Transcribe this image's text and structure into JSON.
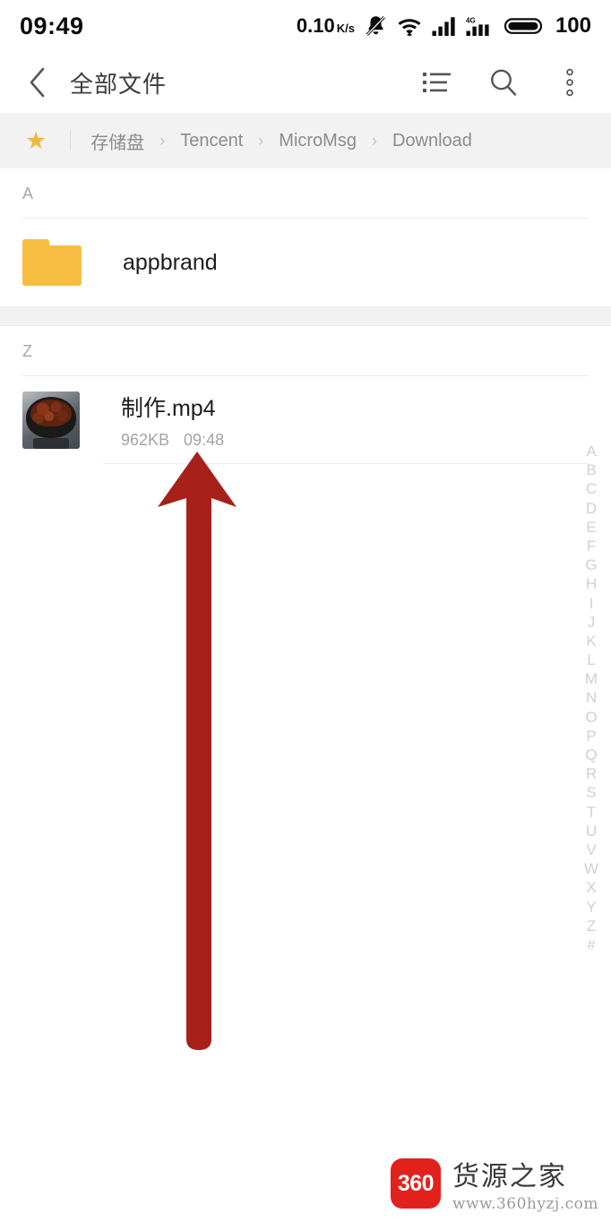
{
  "statusbar": {
    "time": "09:49",
    "net_speed_value": "0.10",
    "net_speed_unit_num": "K",
    "net_speed_unit_den": "s",
    "mute_icon": "bell-muted-icon",
    "wifi_icon": "wifi-icon",
    "signal_icon": "cellular-signal-icon",
    "signal_4g_icon": "cellular-4g-signal-icon",
    "signal_4g_label": "4G",
    "battery_icon": "battery-full-icon",
    "battery_level": "100"
  },
  "appbar": {
    "back_icon": "back-chevron-icon",
    "title": "全部文件",
    "list_view_icon": "list-view-icon",
    "search_icon": "search-icon",
    "more_icon": "more-vertical-icon"
  },
  "breadcrumb": {
    "star_icon": "star-icon",
    "items": [
      {
        "label": "存储盘"
      },
      {
        "label": "Tencent"
      },
      {
        "label": "MicroMsg"
      },
      {
        "label": "Download"
      }
    ],
    "separator": "›"
  },
  "sections": [
    {
      "letter": "A",
      "rows": [
        {
          "type": "folder",
          "icon": "folder-icon",
          "name": "appbrand"
        }
      ]
    },
    {
      "letter": "Z",
      "rows": [
        {
          "type": "video",
          "icon": "video-thumbnail",
          "name": "制作.mp4",
          "size": "962KB",
          "time": "09:48"
        }
      ]
    }
  ],
  "alpha_index": [
    "A",
    "B",
    "C",
    "D",
    "E",
    "F",
    "G",
    "H",
    "I",
    "J",
    "K",
    "L",
    "M",
    "N",
    "O",
    "P",
    "Q",
    "R",
    "S",
    "T",
    "U",
    "V",
    "W",
    "X",
    "Y",
    "Z",
    "#"
  ],
  "annotation": {
    "arrow_icon": "red-up-arrow-annotation",
    "color": "#a8201a"
  },
  "watermark": {
    "badge_text": "360",
    "title": "货源之家",
    "url": "www.360hyzj.com",
    "badge_color": "#e3211c"
  },
  "colors": {
    "folder_yellow": "#f7bd42",
    "star_yellow": "#f2b93c",
    "breadcrumb_bg": "#f2f2f2",
    "text_primary": "#1d1d1d",
    "text_muted": "#a3a3a3"
  }
}
